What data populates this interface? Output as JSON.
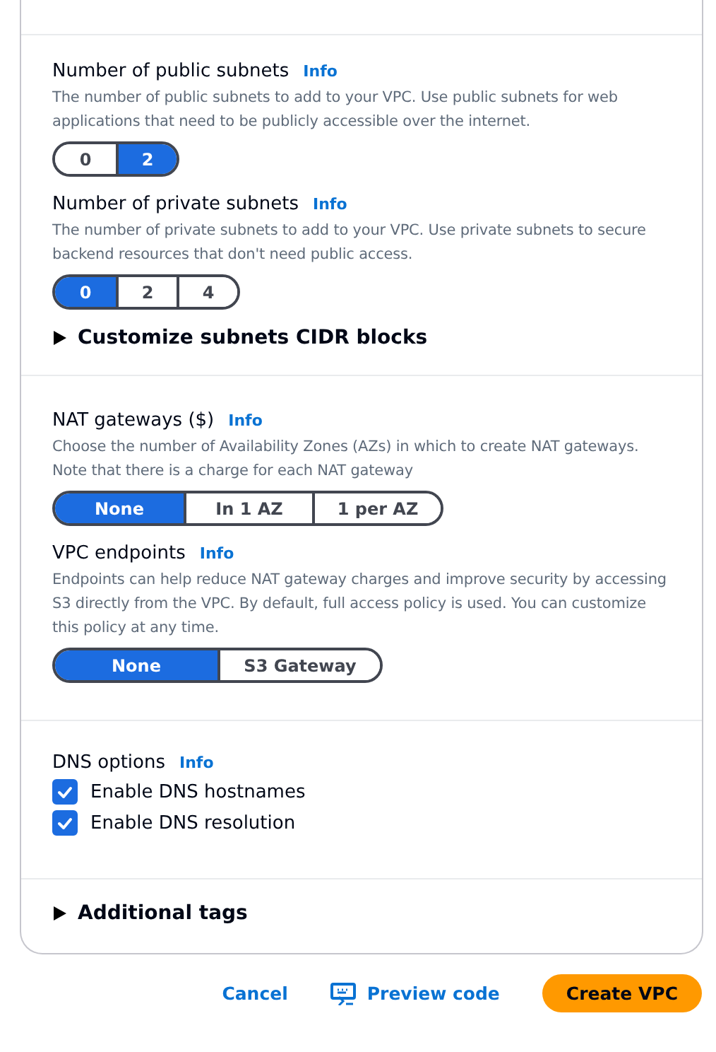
{
  "sections": [
    {
      "items": [
        {
          "kind": "segmented",
          "label": "Number of public subnets",
          "info": "Info",
          "description": "The number of public subnets to add to your VPC. Use public subnets for web applications that need to be publicly accessible over the internet.",
          "options": [
            {
              "label": "0",
              "selected": false
            },
            {
              "label": "2",
              "selected": true
            }
          ]
        },
        {
          "kind": "segmented",
          "label": "Number of private subnets",
          "info": "Info",
          "description": "The number of private subnets to add to your VPC. Use private subnets to secure backend resources that don't need public access.",
          "options": [
            {
              "label": "0",
              "selected": true
            },
            {
              "label": "2",
              "selected": false
            },
            {
              "label": "4",
              "selected": false
            }
          ]
        },
        {
          "kind": "expander",
          "label": "Customize subnets CIDR blocks",
          "expanded": false
        }
      ]
    },
    {
      "items": [
        {
          "kind": "segmented",
          "label": "NAT gateways ($)",
          "info": "Info",
          "description": "Choose the number of Availability Zones (AZs) in which to create NAT gateways. Note that there is a charge for each NAT gateway",
          "options": [
            {
              "label": "None",
              "selected": true
            },
            {
              "label": "In 1 AZ",
              "selected": false
            },
            {
              "label": "1 per AZ",
              "selected": false
            }
          ]
        },
        {
          "kind": "segmented",
          "label": "VPC endpoints",
          "info": "Info",
          "description": "Endpoints can help reduce NAT gateway charges and improve security by accessing S3 directly from the VPC. By default, full access policy is used. You can customize this policy at any time.",
          "options": [
            {
              "label": "None",
              "selected": true
            },
            {
              "label": "S3 Gateway",
              "selected": false
            }
          ]
        }
      ]
    },
    {
      "items": [
        {
          "kind": "checkboxes",
          "label": "DNS options",
          "info": "Info",
          "options": [
            {
              "label": "Enable DNS hostnames",
              "checked": true
            },
            {
              "label": "Enable DNS resolution",
              "checked": true
            }
          ]
        }
      ]
    },
    {
      "items": [
        {
          "kind": "expander",
          "label": "Additional tags",
          "expanded": false
        }
      ]
    }
  ],
  "footer": {
    "cancel": "Cancel",
    "preview": "Preview code",
    "create": "Create VPC"
  }
}
